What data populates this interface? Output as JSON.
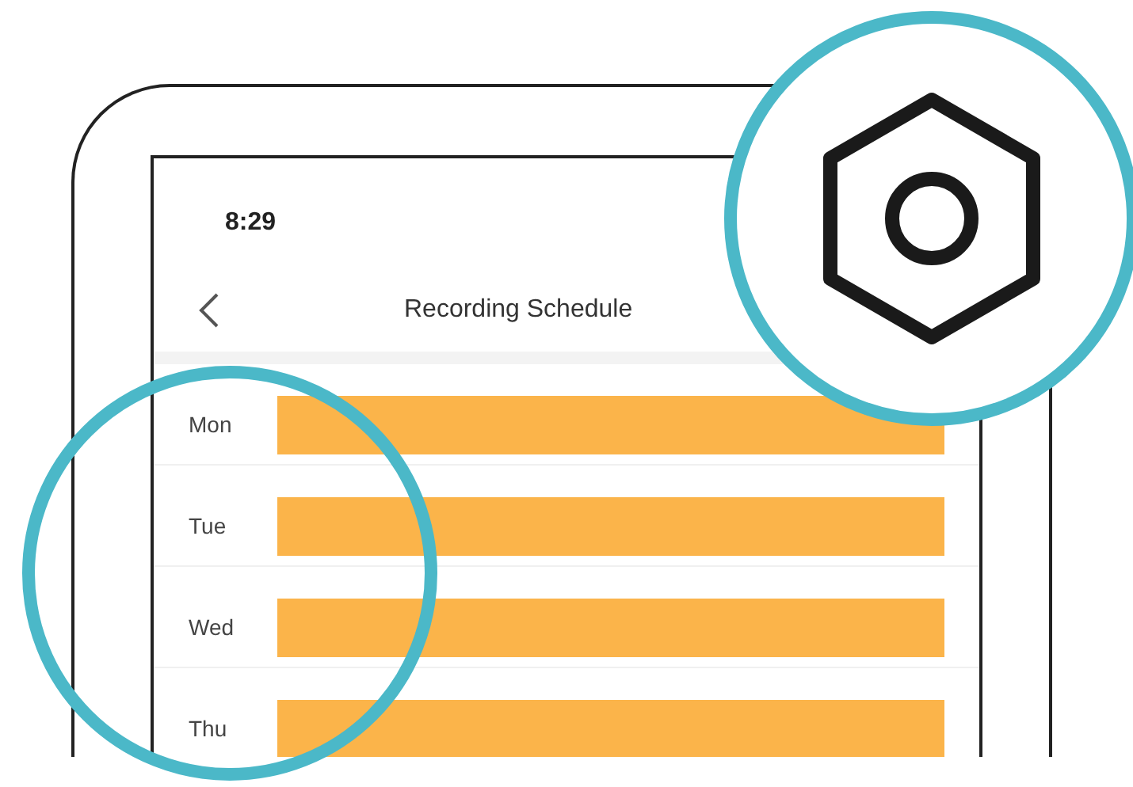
{
  "status_bar": {
    "time": "8:29"
  },
  "nav_bar": {
    "title": "Recording Schedule"
  },
  "schedule": [
    {
      "day": "Mon"
    },
    {
      "day": "Tue"
    },
    {
      "day": "Wed"
    },
    {
      "day": "Thu"
    }
  ]
}
